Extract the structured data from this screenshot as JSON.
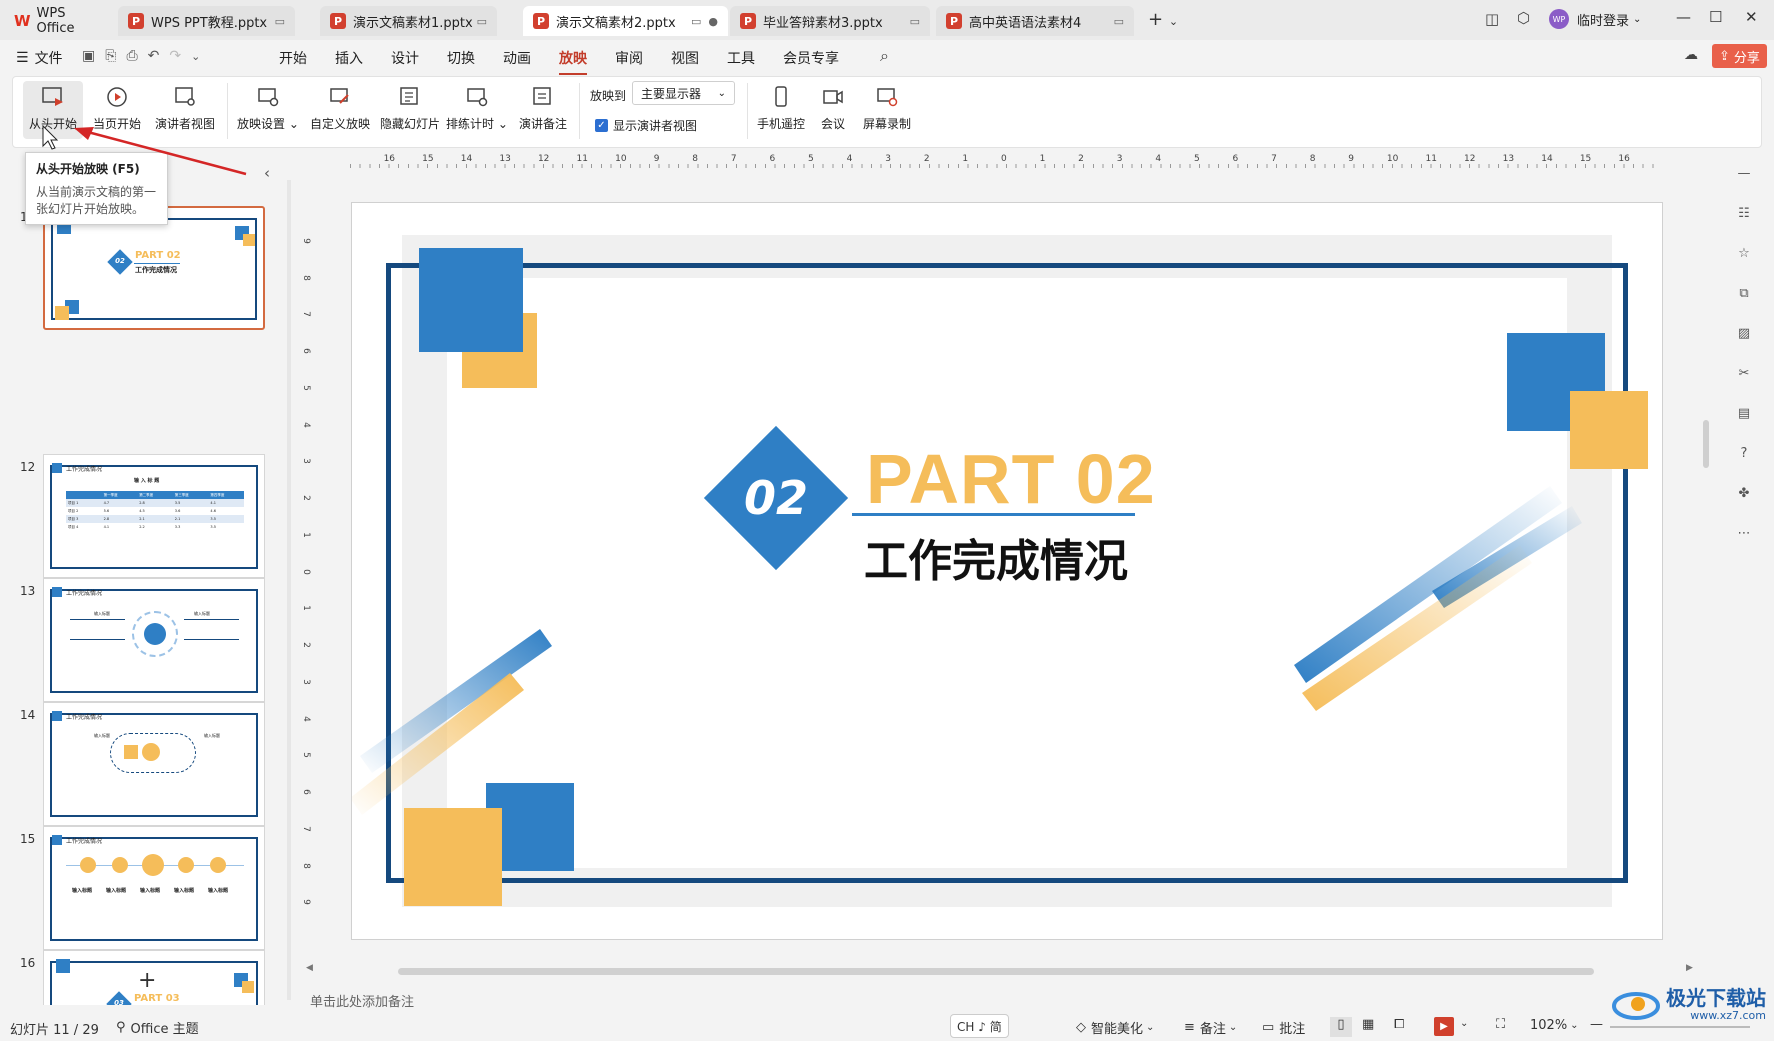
{
  "tabs": [
    {
      "label": "WPS Office"
    },
    {
      "label": "WPS PPT教程.pptx"
    },
    {
      "label": "演示文稿素材1.pptx"
    },
    {
      "label": "演示文稿素材2.pptx"
    },
    {
      "label": "毕业答辩素材3.pptx"
    },
    {
      "label": "高中英语语法素材4"
    }
  ],
  "user": {
    "avatar_text": "WP",
    "login": "临时登录"
  },
  "menu": {
    "file": "文件",
    "items": [
      "开始",
      "插入",
      "设计",
      "切换",
      "动画",
      "放映",
      "审阅",
      "视图",
      "工具",
      "会员专享"
    ],
    "share": "分享"
  },
  "ribbon": {
    "from_start": "从头开始",
    "from_current": "当页开始",
    "presenter_view": "演讲者视图",
    "show_settings": "放映设置",
    "custom_show": "自定义放映",
    "hide_slide": "隐藏幻灯片",
    "rehearse": "排练计时",
    "speaker_notes": "演讲备注",
    "show_on_label": "放映到",
    "show_on_value": "主要显示器",
    "show_presenter_view": "显示演讲者视图",
    "phone_remote": "手机遥控",
    "meeting": "会议",
    "screen_record": "屏幕录制"
  },
  "tooltip": {
    "title": "从头开始放映 (F5)",
    "body": "从当前演示文稿的第一张幻灯片开始放映。"
  },
  "thumbnails": [
    {
      "num": "11",
      "part": "PART 02",
      "subtitle": "工作完成情况",
      "badge": "02"
    },
    {
      "num": "12",
      "title": "工作完成情况",
      "table_title": "输 入 标 题",
      "headers": [
        "",
        "第一季度",
        "第二季度",
        "第三季度",
        "第四季度"
      ],
      "rows": [
        [
          "项目 1",
          "4.7",
          "2.8",
          "3.5",
          "4.1"
        ],
        [
          "项目 2",
          "5.6",
          "4.5",
          "3.6",
          "4.6"
        ],
        [
          "项目 3",
          "2.8",
          "2.1",
          "2.1",
          "3.5"
        ],
        [
          "项目 4",
          "4.1",
          "2.2",
          "3.3",
          "3.5"
        ]
      ]
    },
    {
      "num": "13",
      "title": "工作完成情况",
      "label": "输入标题"
    },
    {
      "num": "14",
      "title": "工作完成情况",
      "label": "输入标题"
    },
    {
      "num": "15",
      "title": "工作完成情况",
      "label": "输入标题"
    },
    {
      "num": "16",
      "part": "PART 03",
      "badge": "03"
    }
  ],
  "ruler": {
    "h": [
      "16",
      "15",
      "14",
      "13",
      "12",
      "11",
      "10",
      "9",
      "8",
      "7",
      "6",
      "5",
      "4",
      "3",
      "2",
      "1",
      "0",
      "1",
      "2",
      "3",
      "4",
      "5",
      "6",
      "7",
      "8",
      "9",
      "10",
      "11",
      "12",
      "13",
      "14",
      "15",
      "16"
    ],
    "v": [
      "9",
      "8",
      "7",
      "6",
      "5",
      "4",
      "3",
      "2",
      "1",
      "0",
      "1",
      "2",
      "3",
      "4",
      "5",
      "6",
      "7",
      "8",
      "9"
    ]
  },
  "slide": {
    "badge": "02",
    "part": "PART 02",
    "subtitle": "工作完成情况"
  },
  "notes_placeholder": "单击此处添加备注",
  "status": {
    "slide_counter": "幻灯片 11 / 29",
    "theme": "Office 主题",
    "ime": "CH ♪ 简",
    "beautify": "智能美化",
    "notes": "备注",
    "comments": "批注",
    "zoom": "102%"
  },
  "watermark": {
    "name": "极光下载站",
    "url": "www.xz7.com"
  },
  "colors": {
    "accent": "#c33d2b",
    "blue": "#2f7fc5",
    "navy": "#15497e",
    "gold": "#f5bd5a"
  }
}
